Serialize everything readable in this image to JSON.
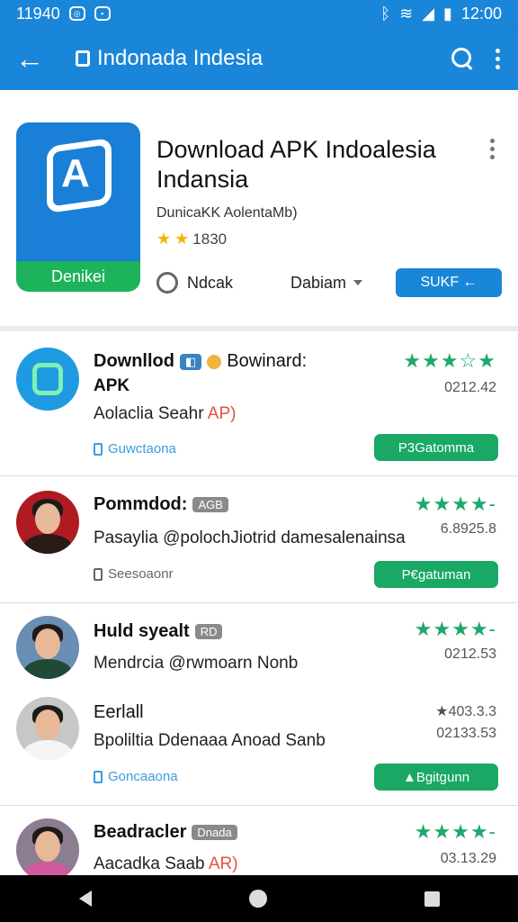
{
  "status_bar": {
    "time_left": "11940",
    "time_right": "12:00"
  },
  "app_bar": {
    "title": "Indonada Indesia",
    "back_icon": "arrow-left-icon",
    "search_icon": "search-icon",
    "menu_icon": "more-vert-icon"
  },
  "hero": {
    "title": "Download APK Indoalesia Indansia",
    "subtitle": "DunicaKK AolentaMb)",
    "rating": "1830",
    "icon_badge": "Denikei",
    "action_chat": "Ndcak",
    "action_dropdown": "Dabiam",
    "action_button": "SUKF ←",
    "accent": "#1a86d9"
  },
  "items": [
    {
      "title": "Downllod",
      "title_extra": "Bowinard:",
      "title_line2": "APK",
      "line": "Aolaclia Seahr",
      "line_accent": "AP)",
      "meta": "Guwctaona",
      "rating_num": "0212.42",
      "button": "P3Gatomma",
      "stars": "★★★☆★"
    },
    {
      "title": "Pommdod:",
      "tag": "AGB",
      "line": "Pasaylia @polochJiotrid damesalenainsa",
      "meta": "Seesoaonr",
      "rating_num": "6.8925.8",
      "button": "P€gatuman",
      "stars": "★★★★-"
    },
    {
      "title": "Huld syealt",
      "tag": "RD",
      "line": "Mendrcia @rwmoarn Nonb",
      "rating_num": "0212.53",
      "stars": "★★★★-"
    },
    {
      "title": "Eerlall",
      "line": "Bpoliltia Ddenaaa Anoad Sanb",
      "meta": "Goncaaona",
      "rating_num": "02133.53",
      "rating_top": "★403.3.3",
      "button": "▲Bgitgunn"
    },
    {
      "title": "Beadracler",
      "tag": "Dnada",
      "line": "Aacadka Saab",
      "line_accent": "AR)",
      "rating_num": "03.13.29",
      "stars": "★★★★-"
    }
  ]
}
